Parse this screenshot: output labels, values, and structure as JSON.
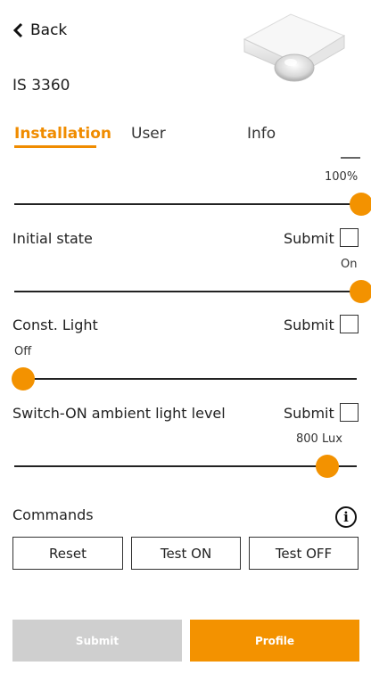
{
  "header": {
    "back_label": "Back",
    "model": "IS 3360"
  },
  "tabs": [
    {
      "label": "Installation",
      "active": true
    },
    {
      "label": "User",
      "active": false
    },
    {
      "label": "Info",
      "active": false
    }
  ],
  "sliders": [
    {
      "value_label": "100%",
      "level": 1.0
    },
    {
      "value_label": "On",
      "level": 1.0
    },
    {
      "value_label": "Off",
      "level": 0.0
    },
    {
      "value_label": "800 Lux",
      "level": 0.9
    }
  ],
  "settings": [
    {
      "label": "Initial state",
      "submit_label": "Submit",
      "checked": false
    },
    {
      "label": "Const. Light",
      "submit_label": "Submit",
      "checked": false
    },
    {
      "label": "Switch-ON ambient light level",
      "submit_label": "Submit",
      "checked": false
    }
  ],
  "commands": {
    "title": "Commands",
    "info_icon": "info-icon",
    "buttons": [
      "Reset",
      "Test ON",
      "Test OFF"
    ]
  },
  "footer": {
    "submit_label": "Submit",
    "profile_label": "Profile"
  },
  "colors": {
    "accent": "#f39200",
    "disabled": "#cfcfcf"
  }
}
